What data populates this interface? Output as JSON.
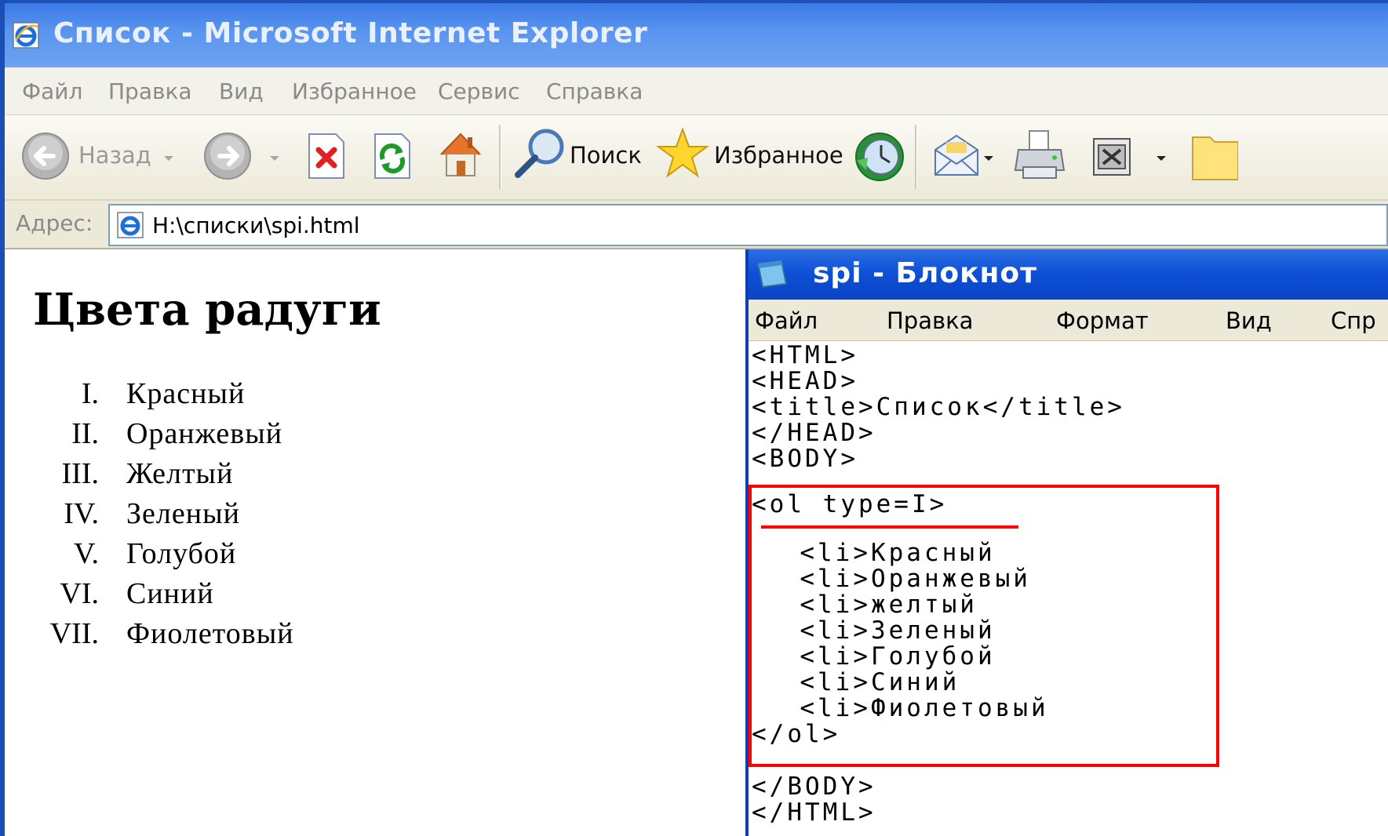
{
  "browser": {
    "title": "Список - Microsoft Internet Explorer",
    "menu": [
      "Файл",
      "Правка",
      "Вид",
      "Избранное",
      "Сервис",
      "Справка"
    ],
    "toolbar": {
      "back_label": "Назад",
      "search_label": "Поиск",
      "favorites_label": "Избранное"
    },
    "address": {
      "label": "Адрес:",
      "value": "H:\\списки\\spi.html"
    }
  },
  "page": {
    "heading": "Цвета радуги",
    "list": [
      {
        "num": "I.",
        "text": "Красный"
      },
      {
        "num": "II.",
        "text": "Оранжевый"
      },
      {
        "num": "III.",
        "text": "Желтый"
      },
      {
        "num": "IV.",
        "text": "Зеленый"
      },
      {
        "num": "V.",
        "text": "Голубой"
      },
      {
        "num": "VI.",
        "text": "Синий"
      },
      {
        "num": "VII.",
        "text": "Фиолетовый"
      }
    ]
  },
  "notepad": {
    "title": "spi - Блокнот",
    "menu": [
      "Файл",
      "Правка",
      "Формат",
      "Вид",
      "Спр"
    ],
    "code_head": "<HTML>\n<HEAD>\n<title>Список</title>\n</HEAD>\n<BODY>",
    "code_ol_open": "<ol type=I>",
    "code_items": "  <li>Красный\n  <li>Оранжевый\n  <li>желтый\n  <li>Зеленый\n  <li>Голубой\n  <li>Синий\n  <li>Фиолетовый",
    "code_ol_close": "</ol>",
    "code_tail": "</BODY>\n</HTML>"
  },
  "colors": {
    "highlight": "#ff0000",
    "ie_title": "#5b95ef",
    "notepad_title": "#0d4fd6"
  }
}
